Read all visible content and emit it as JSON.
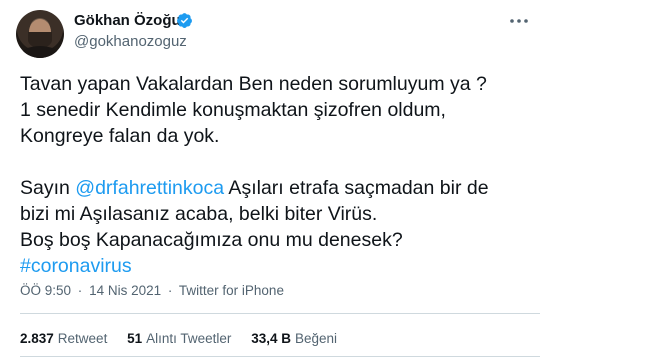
{
  "user": {
    "display_name": "Gökhan Özoğuz",
    "handle": "@gokhanozoguz",
    "verified_icon": "verified-badge-icon",
    "avatar_icon": "profile-photo"
  },
  "menu_icon": "more-options-icon",
  "tweet": {
    "line1": "Tavan yapan Vakalardan Ben neden sorumluyum ya ?",
    "line2": "1 senedir Kendimle konuşmaktan şizofren oldum,",
    "line3": "Kongreye falan da yok.",
    "line4_prefix": "Sayın ",
    "mention": "@drfahrettinkoca",
    "line4_suffix": " Aşıları etrafa saçmadan bir de",
    "line5": "bizi mi Aşılasanız acaba, belki biter Virüs.",
    "line6": "Boş boş Kapanacağımıza onu mu denesek?",
    "hashtag": "#coronavirus"
  },
  "meta": {
    "time": "ÖÖ 9:50",
    "separator": "·",
    "date": "14 Nis 2021",
    "source": "Twitter for iPhone"
  },
  "stats": {
    "retweets_count": "2.837",
    "retweets_label": "Retweet",
    "quotes_count": "51",
    "quotes_label": "Alıntı Tweetler",
    "likes_count": "33,4 B",
    "likes_label": "Beğeni"
  },
  "colors": {
    "link": "#1d9bf0",
    "text": "#0f1419",
    "secondary": "#536471",
    "divider": "#cfd9de"
  }
}
